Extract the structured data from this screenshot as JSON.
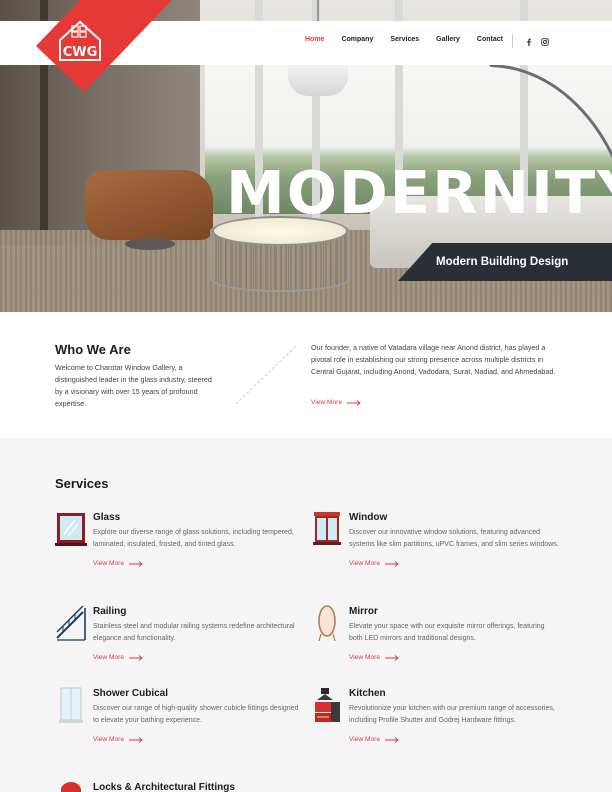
{
  "brand": {
    "logo_text": "CWG",
    "accent": "#e53935",
    "dark": "#2a2f36"
  },
  "nav": {
    "items": [
      {
        "label": "Home",
        "active": true
      },
      {
        "label": "Company",
        "active": false
      },
      {
        "label": "Services",
        "active": false
      },
      {
        "label": "Gallery",
        "active": false
      },
      {
        "label": "Contact",
        "active": false
      }
    ],
    "social": [
      "facebook-icon",
      "instagram-icon"
    ]
  },
  "hero": {
    "title": "MODERNITY",
    "tagline": "Modern Building Design"
  },
  "about": {
    "heading": "Who We Are",
    "lead": "Welcome to Charotar Window Gallery, a distinguished leader in the glass industry, steered by a visionary with over 15 years of profound expertise.",
    "body": "Our founder, a native of Vatadara village near Anond district, has played a pivotal role in establishing our strong presence across multiple districts in Central Gujarat, including Anond, Vadodara, Surat, Nadiad, and Ahmedabad.",
    "more_label": "View More"
  },
  "services": {
    "heading": "Services",
    "items": [
      {
        "title": "Glass",
        "icon": "glass-icon",
        "text": "Explore our diverse range of glass solutions, including tempered, laminated, insulated, frosted, and tinted glass.",
        "more_label": "View More"
      },
      {
        "title": "Window",
        "icon": "window-icon",
        "text": "Discover our innovative window solutions, featuring advanced systems like slim partitions, uPVC frames, and slim series windows.",
        "more_label": "View More"
      },
      {
        "title": "Railing",
        "icon": "railing-icon",
        "text": "Stainless steel and modular railing systems redefine architectural elegance and functionality.",
        "more_label": "View More"
      },
      {
        "title": "Mirror",
        "icon": "mirror-icon",
        "text": "Elevate your space with our exquisite mirror offerings, featuring both LED mirrors and traditional designs.",
        "more_label": "View More"
      },
      {
        "title": "Shower Cubical",
        "icon": "shower-icon",
        "text": "Discover our range of high-quality shower cubicle fittings designed to elevate your bathing experience.",
        "more_label": "View More"
      },
      {
        "title": "Kitchen",
        "icon": "kitchen-icon",
        "text": "Revolutionize your kitchen with our premium range of accessories, including Profile Shutter and Godrej Hardware fittings.",
        "more_label": "View More"
      },
      {
        "title": "Locks & Architectural Fittings",
        "icon": "lock-icon",
        "text": "",
        "more_label": ""
      }
    ]
  }
}
